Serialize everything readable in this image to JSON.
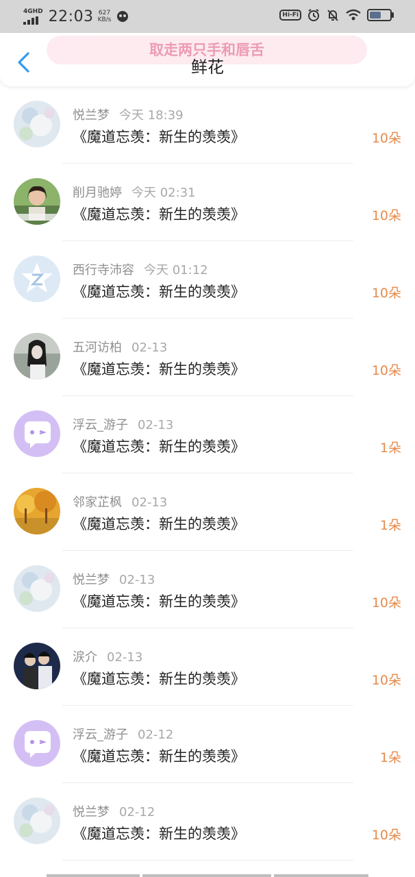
{
  "status_bar": {
    "network": "4GHD",
    "time": "22:03",
    "speed_value": "627",
    "speed_unit": "KB/s",
    "hifi_label": "Hi-Fi",
    "battery_level": 0.6
  },
  "nav": {
    "banner_text": "取走两只手和唇舌",
    "title": "鲜花"
  },
  "colors": {
    "count": "#e68a4a",
    "banner": "#fde8ee"
  },
  "rows": [
    {
      "name": "悦兰梦",
      "time": "今天 18:39",
      "work": "《魔道忘羡：新生的羡羡》",
      "count": "10朵",
      "avatar": "floral-avatar"
    },
    {
      "name": "削月驰婷",
      "time": "今天 02:31",
      "work": "《魔道忘羡：新生的羡羡》",
      "count": "10朵",
      "avatar": "girl-photo-avatar"
    },
    {
      "name": "西行寺沛容",
      "time": "今天 01:12",
      "work": "《魔道忘羡：新生的羡羡》",
      "count": "10朵",
      "avatar": "default-z-avatar"
    },
    {
      "name": "五河访柏",
      "time": "02-13",
      "work": "《魔道忘羡：新生的羡羡》",
      "count": "10朵",
      "avatar": "girl-bw-avatar"
    },
    {
      "name": "浮云_游子",
      "time": "02-13",
      "work": "《魔道忘羡：新生的羡羡》",
      "count": "1朵",
      "avatar": "purple-chat-avatar"
    },
    {
      "name": "邻家芷枫",
      "time": "02-13",
      "work": "《魔道忘羡：新生的羡羡》",
      "count": "1朵",
      "avatar": "autumn-trees-avatar"
    },
    {
      "name": "悦兰梦",
      "time": "02-13",
      "work": "《魔道忘羡：新生的羡羡》",
      "count": "10朵",
      "avatar": "floral-avatar"
    },
    {
      "name": "涙介",
      "time": "02-13",
      "work": "《魔道忘羡：新生的羡羡》",
      "count": "10朵",
      "avatar": "costume-avatar"
    },
    {
      "name": "浮云_游子",
      "time": "02-12",
      "work": "《魔道忘羡：新生的羡羡》",
      "count": "1朵",
      "avatar": "purple-chat-avatar"
    },
    {
      "name": "悦兰梦",
      "time": "02-12",
      "work": "《魔道忘羡：新生的羡羡》",
      "count": "10朵",
      "avatar": "floral-avatar"
    }
  ]
}
